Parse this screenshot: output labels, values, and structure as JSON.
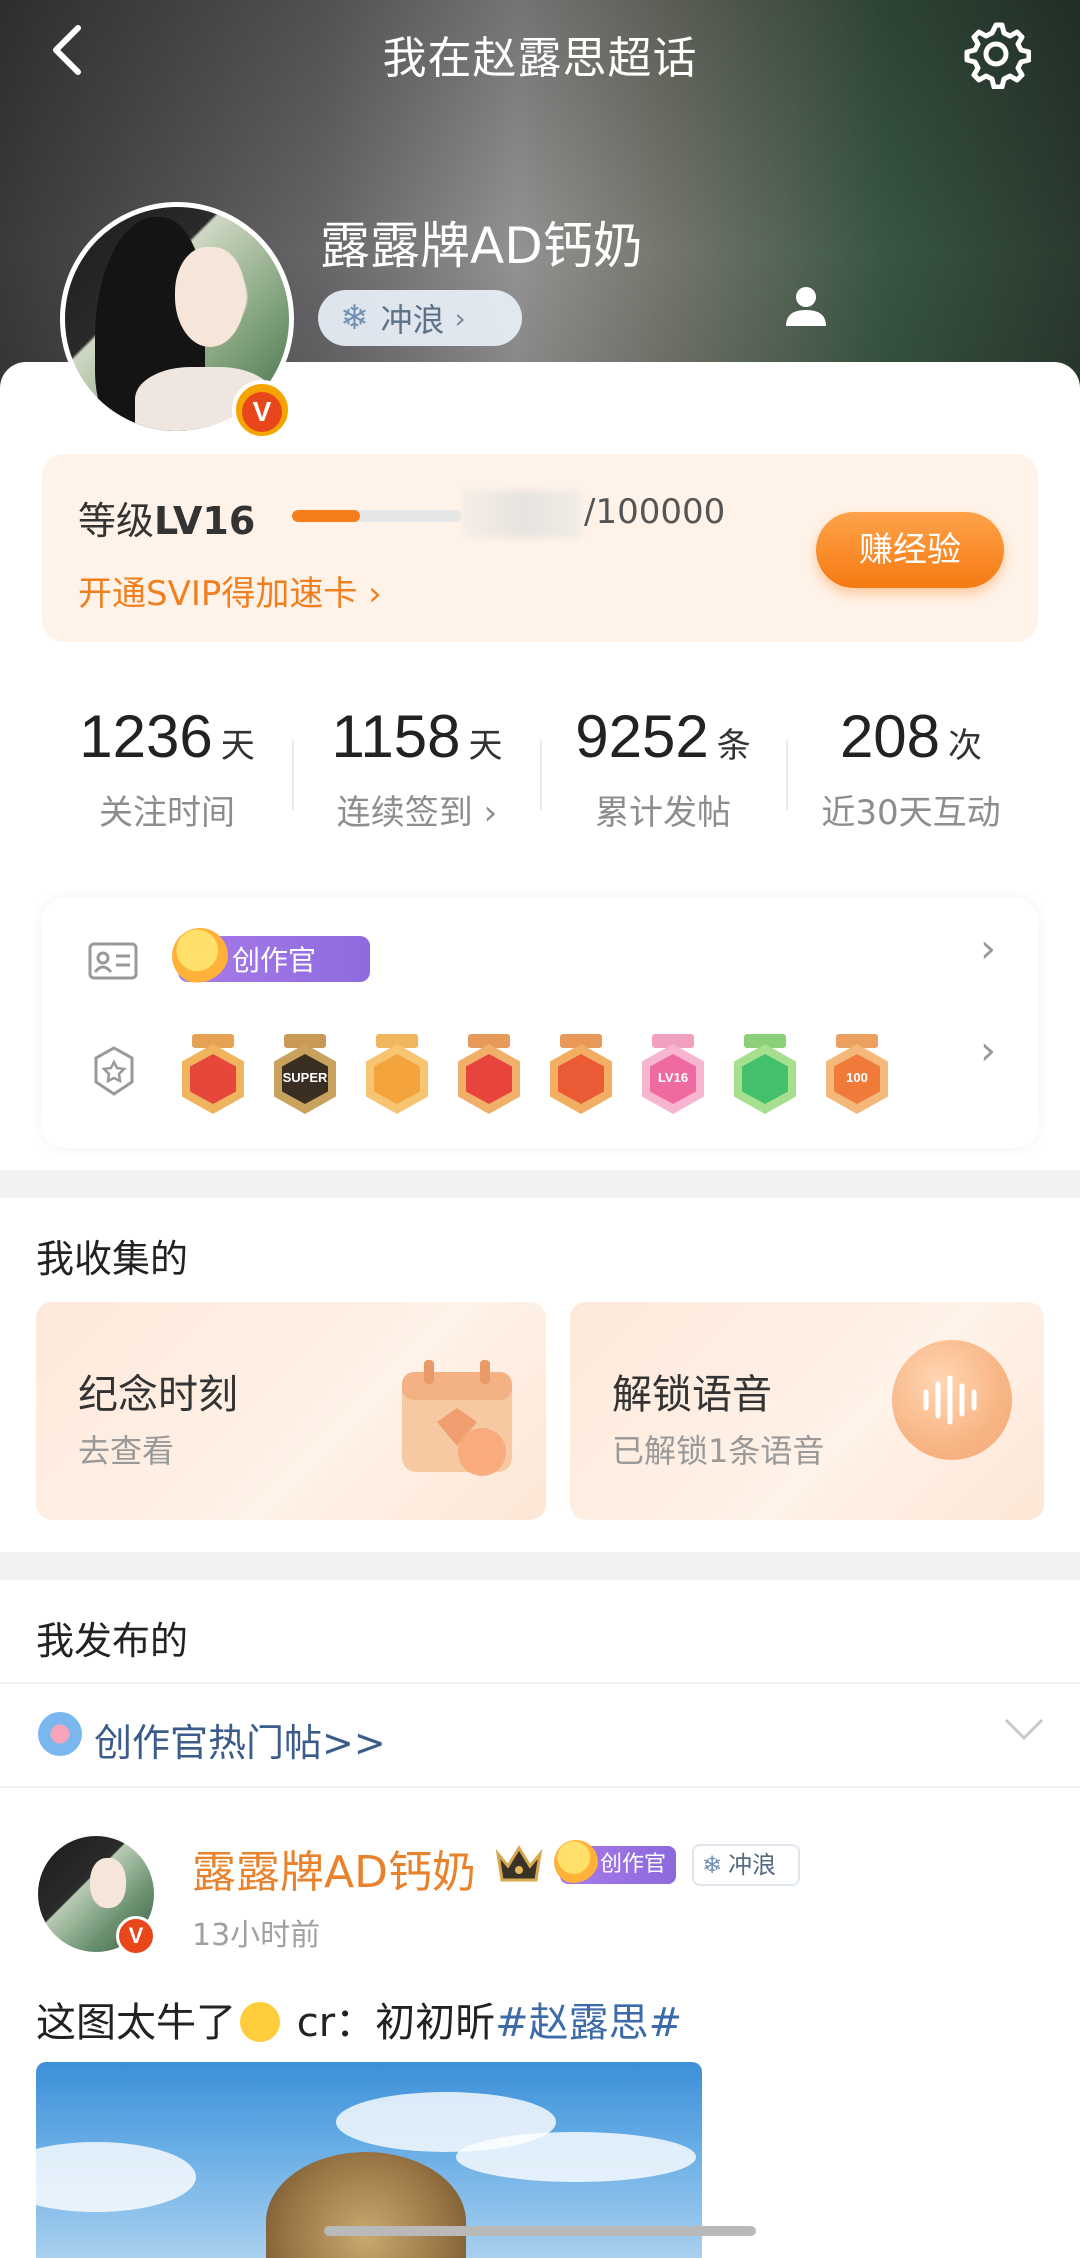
{
  "header": {
    "title": "我在赵露思超话",
    "back_icon": "chevron-left-icon",
    "settings_icon": "gear-icon"
  },
  "profile": {
    "username": "露露牌AD钙奶",
    "surf_label": "冲浪",
    "verified_badge": "V"
  },
  "level": {
    "label_prefix": "等级",
    "level": "LV16",
    "max": "/100000",
    "progress_fraction": 0.4,
    "svip_text": "开通SVIP得加速卡 ›",
    "earn_button": "赚经验"
  },
  "stats": [
    {
      "value": "1236",
      "unit": "天",
      "label": "关注时间"
    },
    {
      "value": "1158",
      "unit": "天",
      "label": "连续签到 ›"
    },
    {
      "value": "9252",
      "unit": "条",
      "label": "累计发帖"
    },
    {
      "value": "208",
      "unit": "次",
      "label": "近30天互动"
    }
  ],
  "badges": {
    "creator_label": "创作官",
    "medals": [
      {
        "name": "fox-medal",
        "text": ""
      },
      {
        "name": "super-crown-medal",
        "text": "SUPER"
      },
      {
        "name": "crown-medal",
        "text": ""
      },
      {
        "name": "cat-medal",
        "text": ""
      },
      {
        "name": "fire-cat-medal",
        "text": ""
      },
      {
        "name": "lv16-medal",
        "text": "LV16"
      },
      {
        "name": "hand-medal",
        "text": ""
      },
      {
        "name": "100-days-medal",
        "text": "100"
      }
    ]
  },
  "collect": {
    "title": "我收集的",
    "cards": [
      {
        "title": "纪念时刻",
        "subtitle": "去查看"
      },
      {
        "title": "解锁语音",
        "subtitle": "已解锁1条语音"
      }
    ]
  },
  "posted": {
    "title": "我发布的",
    "hot_link": "创作官热门帖>>"
  },
  "post": {
    "author": "露露牌AD钙奶",
    "creator_label": "创作官",
    "surf_label": "冲浪",
    "time": "13小时前",
    "text_before": "这图太牛了",
    "text_after": " cr：初初昕",
    "hashtag": "#赵露思#"
  },
  "colors": {
    "accent_orange": "#f77d1b",
    "link_blue": "#3d6aa8",
    "author_orange": "#e8822c"
  }
}
